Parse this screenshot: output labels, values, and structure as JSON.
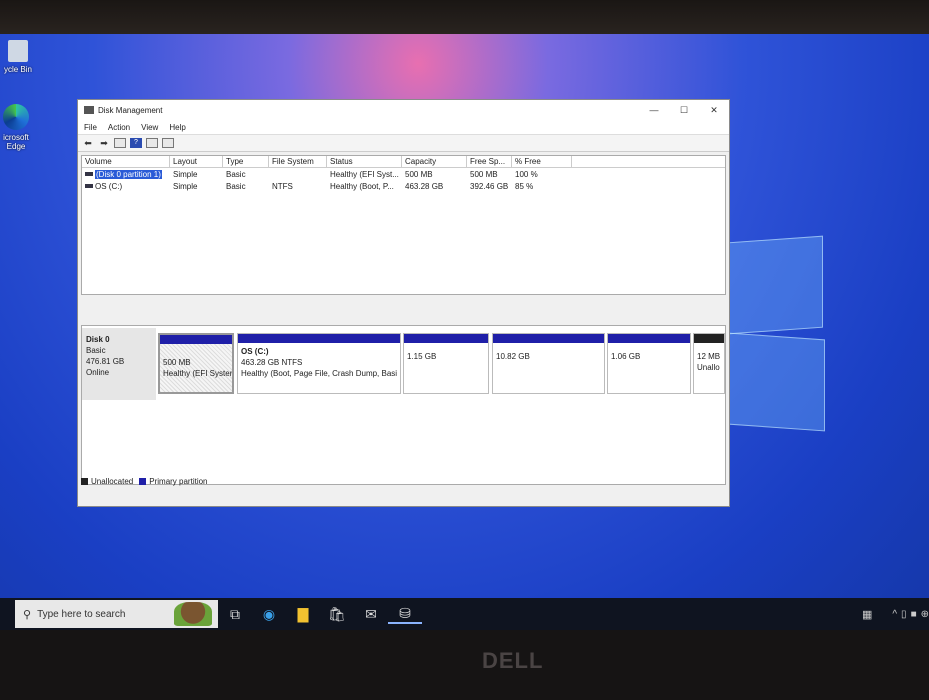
{
  "desktop": {
    "icons": [
      {
        "label": "ycle Bin"
      },
      {
        "label": "icrosoft Edge"
      }
    ]
  },
  "window": {
    "title": "Disk Management",
    "controls": [
      "—",
      "☐",
      "✕"
    ]
  },
  "menu": [
    "File",
    "Action",
    "View",
    "Help"
  ],
  "list": {
    "columns": [
      "Volume",
      "Layout",
      "Type",
      "File System",
      "Status",
      "Capacity",
      "Free Sp...",
      "% Free"
    ],
    "rows": [
      [
        "(Disk 0 partition 1)",
        "Simple",
        "Basic",
        "",
        "Healthy (EFI Syst...",
        "500 MB",
        "500 MB",
        "100 %"
      ],
      [
        "OS (C:)",
        "Simple",
        "Basic",
        "NTFS",
        "Healthy (Boot, P...",
        "463.28 GB",
        "392.46 GB",
        "85 %"
      ]
    ]
  },
  "disk": {
    "name": "Disk 0",
    "type": "Basic",
    "size": "476.81 GB",
    "status": "Online",
    "partitions": [
      {
        "title": "",
        "size": "500 MB",
        "status": "Healthy (EFI Syster"
      },
      {
        "title": "OS  (C:)",
        "size": "463.28 GB NTFS",
        "status": "Healthy (Boot, Page File, Crash Dump, Basi"
      },
      {
        "title": "",
        "size": "1.15 GB",
        "status": ""
      },
      {
        "title": "",
        "size": "10.82 GB",
        "status": ""
      },
      {
        "title": "",
        "size": "1.06 GB",
        "status": ""
      },
      {
        "title": "",
        "size": "12 MB",
        "status": "Unallo"
      }
    ]
  },
  "legend": {
    "unallocated": "Unallocated",
    "primary": "Primary partition"
  },
  "colors": {
    "primary": "#1f1fa8",
    "unallocated": "#222222"
  },
  "taskbar": {
    "search_placeholder": "Type here to search"
  },
  "bezel": {
    "brand": "DELL"
  }
}
